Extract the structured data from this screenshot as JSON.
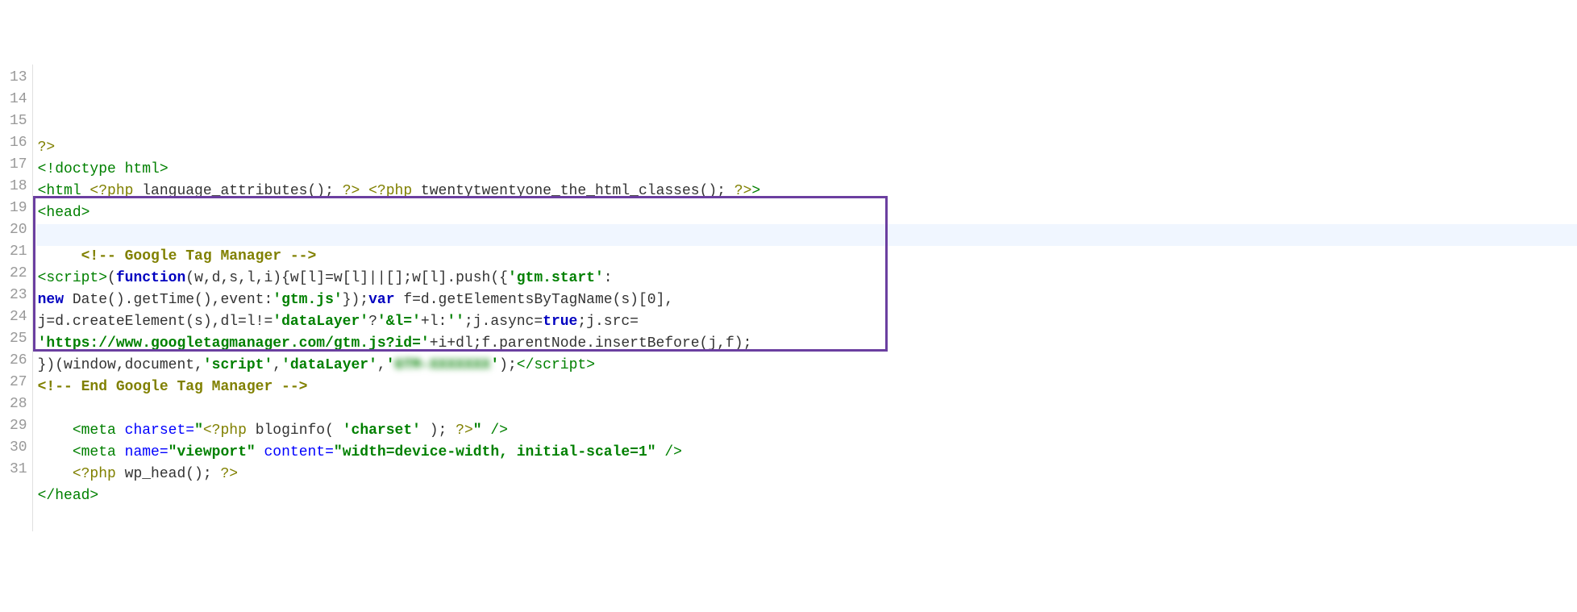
{
  "line_numbers": [
    "13",
    "14",
    "15",
    "16",
    "17",
    "18",
    "19",
    "20",
    "21",
    "22",
    "23",
    "24",
    "25",
    "26",
    "27",
    "28",
    "29",
    "30",
    "31"
  ],
  "highlight_box": {
    "top_line": 19,
    "bottom_line": 25
  },
  "lines": {
    "l13": [],
    "l14": [
      {
        "cls": "t-phptag",
        "text": "?>"
      }
    ],
    "l15": [
      {
        "cls": "t-tag",
        "text": "<!doctype html>"
      }
    ],
    "l16": [
      {
        "cls": "t-tag",
        "text": "<html "
      },
      {
        "cls": "t-phptag",
        "text": "<?php "
      },
      {
        "cls": "t-default",
        "text": "language_attributes(); "
      },
      {
        "cls": "t-phptag",
        "text": "?>"
      },
      {
        "cls": "t-default",
        "text": " "
      },
      {
        "cls": "t-phptag",
        "text": "<?php "
      },
      {
        "cls": "t-default",
        "text": "twentytwentyone_the_html_classes(); "
      },
      {
        "cls": "t-phptag",
        "text": "?>"
      },
      {
        "cls": "t-tag",
        "text": ">"
      }
    ],
    "l17": [
      {
        "cls": "t-tag",
        "text": "<head>"
      }
    ],
    "l18": [],
    "l19": [
      {
        "cls": "t-default",
        "text": "     "
      },
      {
        "cls": "t-comment",
        "text": "<!-- Google Tag Manager -->"
      }
    ],
    "l20": [
      {
        "cls": "t-tag",
        "text": "<script>"
      },
      {
        "cls": "t-default",
        "text": "("
      },
      {
        "cls": "t-keyword",
        "text": "function"
      },
      {
        "cls": "t-default",
        "text": "(w,d,s,l,i){w[l]=w[l]||[];w[l].push({"
      },
      {
        "cls": "t-str",
        "text": "'gtm.start'"
      },
      {
        "cls": "t-default",
        "text": ":"
      }
    ],
    "l21": [
      {
        "cls": "t-keyword",
        "text": "new "
      },
      {
        "cls": "t-default",
        "text": "Date().getTime(),event:"
      },
      {
        "cls": "t-str",
        "text": "'gtm.js'"
      },
      {
        "cls": "t-default",
        "text": "});"
      },
      {
        "cls": "t-keyword",
        "text": "var "
      },
      {
        "cls": "t-default",
        "text": "f=d.getElementsByTagName(s)[0],"
      }
    ],
    "l22": [
      {
        "cls": "t-default",
        "text": "j=d.createElement(s),dl=l!="
      },
      {
        "cls": "t-str",
        "text": "'dataLayer'"
      },
      {
        "cls": "t-default",
        "text": "?"
      },
      {
        "cls": "t-str",
        "text": "'&l='"
      },
      {
        "cls": "t-default",
        "text": "+l:"
      },
      {
        "cls": "t-str",
        "text": "''"
      },
      {
        "cls": "t-default",
        "text": ";j.async="
      },
      {
        "cls": "t-keyword",
        "text": "true"
      },
      {
        "cls": "t-default",
        "text": ";j.src="
      }
    ],
    "l23": [
      {
        "cls": "t-str",
        "text": "'https://www.googletagmanager.com/gtm.js?id='"
      },
      {
        "cls": "t-default",
        "text": "+i+dl;f.parentNode.insertBefore(j,f);"
      }
    ],
    "l24": [
      {
        "cls": "t-default",
        "text": "})(window,document,"
      },
      {
        "cls": "t-str",
        "text": "'script'"
      },
      {
        "cls": "t-default",
        "text": ","
      },
      {
        "cls": "t-str",
        "text": "'dataLayer'"
      },
      {
        "cls": "t-default",
        "text": ","
      },
      {
        "cls": "t-str",
        "text": "'"
      },
      {
        "cls": "t-str blur",
        "text": "GTM-XXXXXXX"
      },
      {
        "cls": "t-str",
        "text": "'"
      },
      {
        "cls": "t-default",
        "text": ");"
      },
      {
        "cls": "t-tag",
        "text": "</script>"
      }
    ],
    "l25": [
      {
        "cls": "t-comment",
        "text": "<!-- End Google Tag Manager -->"
      }
    ],
    "l26": [],
    "l27": [
      {
        "cls": "t-default",
        "text": "    "
      },
      {
        "cls": "t-tag",
        "text": "<meta "
      },
      {
        "cls": "t-attr",
        "text": "charset="
      },
      {
        "cls": "t-str",
        "text": "\""
      },
      {
        "cls": "t-phptag",
        "text": "<?php "
      },
      {
        "cls": "t-default",
        "text": "bloginfo( "
      },
      {
        "cls": "t-str",
        "text": "'charset'"
      },
      {
        "cls": "t-default",
        "text": " ); "
      },
      {
        "cls": "t-phptag",
        "text": "?>"
      },
      {
        "cls": "t-str",
        "text": "\""
      },
      {
        "cls": "t-tag",
        "text": " />"
      }
    ],
    "l28": [
      {
        "cls": "t-default",
        "text": "    "
      },
      {
        "cls": "t-tag",
        "text": "<meta "
      },
      {
        "cls": "t-attr",
        "text": "name="
      },
      {
        "cls": "t-str",
        "text": "\"viewport\""
      },
      {
        "cls": "t-attr",
        "text": " content="
      },
      {
        "cls": "t-str",
        "text": "\"width=device-width, initial-scale=1\""
      },
      {
        "cls": "t-tag",
        "text": " />"
      }
    ],
    "l29": [
      {
        "cls": "t-default",
        "text": "    "
      },
      {
        "cls": "t-phptag",
        "text": "<?php "
      },
      {
        "cls": "t-default",
        "text": "wp_head(); "
      },
      {
        "cls": "t-phptag",
        "text": "?>"
      }
    ],
    "l30": [
      {
        "cls": "t-tag",
        "text": "</head>"
      }
    ],
    "l31": []
  }
}
